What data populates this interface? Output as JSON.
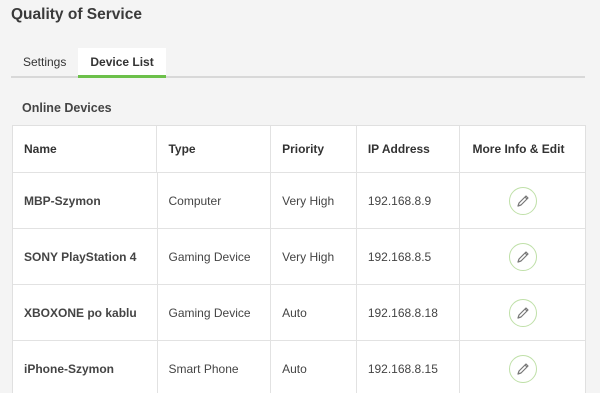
{
  "page_title": "Quality of Service",
  "tabs": [
    {
      "label": "Settings",
      "active": false
    },
    {
      "label": "Device List",
      "active": true
    }
  ],
  "section_title": "Online Devices",
  "table": {
    "columns": [
      "Name",
      "Type",
      "Priority",
      "IP Address",
      "More Info & Edit"
    ],
    "rows": [
      {
        "name": "MBP-Szymon",
        "type": "Computer",
        "priority": "Very High",
        "ip": "192.168.8.9"
      },
      {
        "name": "SONY PlayStation 4",
        "type": "Gaming Device",
        "priority": "Very High",
        "ip": "192.168.8.5"
      },
      {
        "name": "XBOXONE po kablu",
        "type": "Gaming Device",
        "priority": "Auto",
        "ip": "192.168.8.18"
      },
      {
        "name": "iPhone-Szymon",
        "type": "Smart Phone",
        "priority": "Auto",
        "ip": "192.168.8.15"
      }
    ]
  },
  "icons": {
    "edit": "pencil-icon"
  },
  "colors": {
    "accent": "#6cc04a",
    "edit_border": "#bfe0a8",
    "background": "#f4f4f4"
  }
}
